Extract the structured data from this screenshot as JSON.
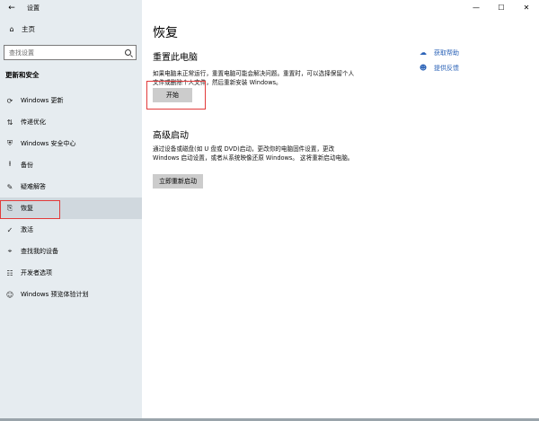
{
  "window": {
    "title": "设置",
    "controls": {
      "minimize": "—",
      "maximize": "☐",
      "close": "✕"
    }
  },
  "sidebar": {
    "home_label": "主页",
    "search_placeholder": "查找设置",
    "section_title": "更新和安全",
    "items": [
      {
        "label": "Windows 更新",
        "icon": "sync-icon",
        "glyph": "⟳"
      },
      {
        "label": "传递优化",
        "icon": "delivery-icon",
        "glyph": "⇅"
      },
      {
        "label": "Windows 安全中心",
        "icon": "shield-icon",
        "glyph": "⛨"
      },
      {
        "label": "备份",
        "icon": "backup-icon",
        "glyph": "⭱"
      },
      {
        "label": "疑难解答",
        "icon": "wrench-icon",
        "glyph": "✎"
      },
      {
        "label": "恢复",
        "icon": "recovery-icon",
        "glyph": "⎘"
      },
      {
        "label": "激活",
        "icon": "check-circle-icon",
        "glyph": "✓"
      },
      {
        "label": "查找我的设备",
        "icon": "person-location-icon",
        "glyph": "⌖"
      },
      {
        "label": "开发者选项",
        "icon": "developer-icon",
        "glyph": "☷"
      },
      {
        "label": "Windows 预览体验计划",
        "icon": "insider-icon",
        "glyph": "☺"
      }
    ],
    "active_index": 5
  },
  "main": {
    "title": "恢复",
    "reset": {
      "heading": "重置此电脑",
      "description": "如果电脑未正常运行，重置电脑可能会解决问题。重置时，可以选择保留个人文件或删除个人文件，然后重新安装 Windows。",
      "button": "开始"
    },
    "advanced": {
      "heading": "高级启动",
      "description": "通过设备或磁盘(如 U 盘或 DVD)启动，更改你的电脑固件设置，更改 Windows 启动设置，或者从系统映像还原 Windows。 这将重新启动电脑。",
      "button": "立即重新启动"
    },
    "help_links": [
      {
        "label": "获取帮助",
        "icon": "help-chat-icon",
        "glyph": "☁"
      },
      {
        "label": "提供反馈",
        "icon": "feedback-icon",
        "glyph": "☻"
      }
    ]
  },
  "colors": {
    "sidebar_bg": "#e6ecf0",
    "highlight_outline": "#e23a3a",
    "link": "#2a62b7",
    "button_bg": "#cccccc"
  }
}
